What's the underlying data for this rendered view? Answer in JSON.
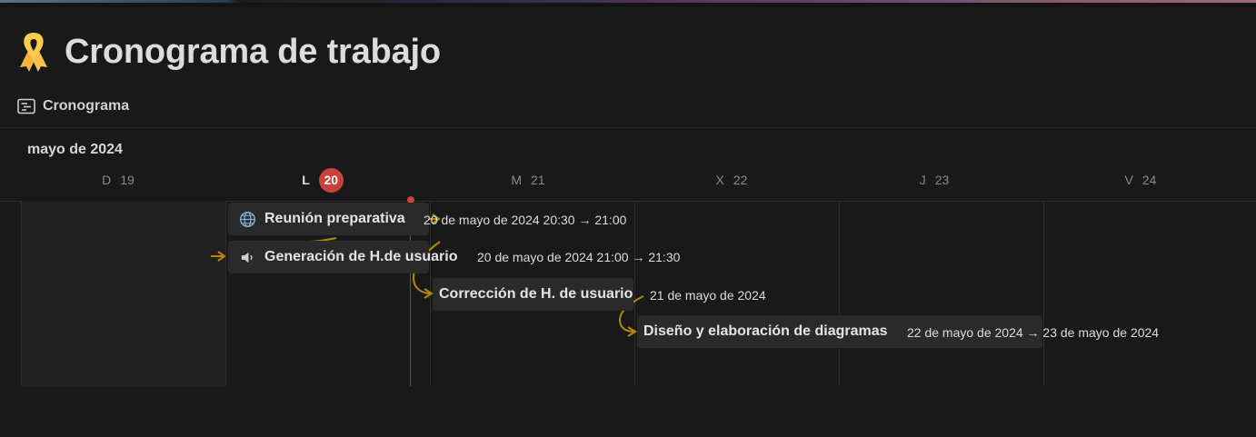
{
  "page": {
    "title": "Cronograma de trabajo",
    "icon": "yellow-ribbon-icon"
  },
  "view_tab": {
    "label": "Cronograma",
    "icon": "timeline-view-icon"
  },
  "month_label": "mayo de 2024",
  "days": [
    {
      "letter": "D",
      "num": "19"
    },
    {
      "letter": "L",
      "num": "20",
      "today": true
    },
    {
      "letter": "M",
      "num": "21"
    },
    {
      "letter": "X",
      "num": "22"
    },
    {
      "letter": "J",
      "num": "23"
    },
    {
      "letter": "V",
      "num": "24"
    }
  ],
  "tasks": [
    {
      "title": "Reunión preparativa",
      "dates": "20 de mayo de 2024 20:30 → 21:00",
      "icon": "globe-icon"
    },
    {
      "title": "Generación de H.de usuario",
      "dates": "20 de mayo de 2024 21:00 → 21:30",
      "icon": "speaker-icon"
    },
    {
      "title": "Corrección de H. de usuario",
      "dates": "21 de mayo de 2024"
    },
    {
      "title": "Diseño y elaboración de diagramas",
      "dates": "22 de mayo de 2024 → 23 de mayo de 2024"
    }
  ],
  "colors": {
    "background": "#191919",
    "bar": "#2a2a2a",
    "today": "#c8423c",
    "dependency": "#b8860b"
  }
}
